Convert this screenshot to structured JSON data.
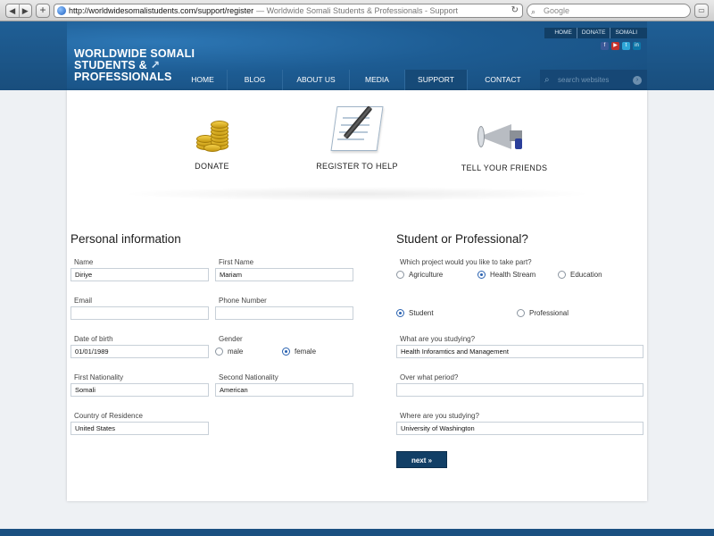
{
  "browser": {
    "url": "http://worldwidesomalistudents.com/support/register",
    "page_title": "— Worldwide Somali Students & Professionals - Support",
    "search_placeholder": "Google",
    "back": "◀",
    "forward": "▶",
    "new_tab": "+",
    "reload": "↻"
  },
  "site": {
    "logo_lines": [
      "WORLDWIDE SOMALI",
      "STUDENTS &",
      "PROFESSIONALS"
    ],
    "top_links": [
      "HOME",
      "DONATE",
      "SOMALI"
    ],
    "social_icons": [
      "facebook-icon",
      "youtube-icon",
      "twitter-icon",
      "linkedin-icon"
    ],
    "nav": [
      "HOME",
      "BLOG",
      "ABOUT US",
      "MEDIA",
      "SUPPORT",
      "CONTACT"
    ],
    "active_nav": "SUPPORT",
    "search_placeholder": "search websites"
  },
  "features": {
    "donate": "DONATE",
    "register": "REGISTER TO HELP",
    "tell": "TELL YOUR FRIENDS"
  },
  "personal": {
    "title": "Personal information",
    "name_label": "Name",
    "name_value": "Diriye",
    "first_name_label": "First Name",
    "first_name_value": "Mariam",
    "email_label": "Email",
    "email_value": "",
    "phone_label": "Phone Number",
    "phone_value": "",
    "dob_label": "Date of birth",
    "dob_value": "01/01/1989",
    "gender_label": "Gender",
    "gender_male": "male",
    "gender_female": "female",
    "gender_selected": "female",
    "first_nat_label": "First Nationality",
    "first_nat_value": "Somali",
    "second_nat_label": "Second Nationality",
    "second_nat_value": "American",
    "residence_label": "Country of Residence",
    "residence_value": "United States"
  },
  "student": {
    "title": "Student or Professional?",
    "project_label": "Which project would you like to take part?",
    "project_options": [
      "Agriculture",
      "Health Stream",
      "Education"
    ],
    "project_selected": "Health Stream",
    "role_options": [
      "Student",
      "Professional"
    ],
    "role_selected": "Student",
    "study_label": "What are you studying?",
    "study_value": "Health Inforamtics and Management",
    "period_label": "Over what period?",
    "period_value": "",
    "where_label": "Where are you studying?",
    "where_value": "University of Washington",
    "next_label": "next »"
  }
}
